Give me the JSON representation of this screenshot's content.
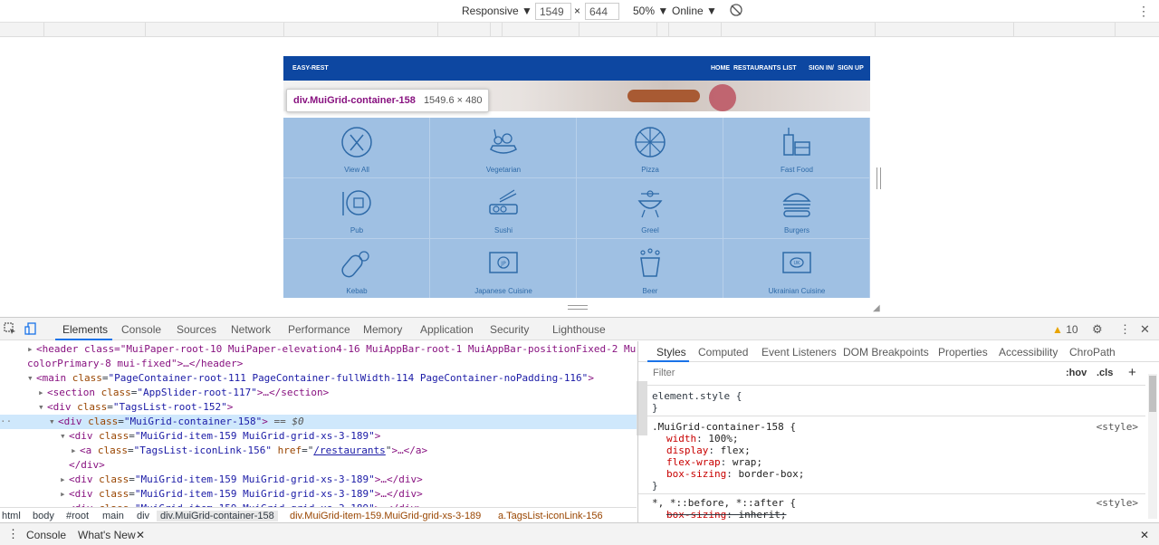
{
  "device_toolbar": {
    "mode": "Responsive",
    "width": "1549",
    "times": "×",
    "height": "644",
    "zoom": "50%",
    "network": "Online"
  },
  "site": {
    "brand": "EASY-REST",
    "nav": [
      "HOME",
      "RESTAURANTS LIST",
      "SIGN IN",
      "/",
      "SIGN UP"
    ],
    "tags": [
      {
        "label": "View All",
        "icon": "cutlery-icon"
      },
      {
        "label": "Vegetarian",
        "icon": "vegetables-icon"
      },
      {
        "label": "Pizza",
        "icon": "pizza-icon"
      },
      {
        "label": "Fast Food",
        "icon": "fast-food-icon"
      },
      {
        "label": "Pub",
        "icon": "pub-icon"
      },
      {
        "label": "Sushi",
        "icon": "sushi-icon"
      },
      {
        "label": "Greel",
        "icon": "grill-icon"
      },
      {
        "label": "Burgers",
        "icon": "burger-icon"
      },
      {
        "label": "Kebab",
        "icon": "kebab-icon"
      },
      {
        "label": "Japanese Cuisine",
        "icon": "japanese-cuisine-icon"
      },
      {
        "label": "Beer",
        "icon": "beer-icon"
      },
      {
        "label": "Ukrainian Cuisine",
        "icon": "ukrainian-cuisine-icon"
      }
    ],
    "icon_badges": {
      "japanese": "JP",
      "ukrainian": "UK"
    }
  },
  "tooltip": {
    "selector": "div.MuiGrid-container-158",
    "dimensions": "1549.6 × 480"
  },
  "devtools": {
    "tabs": [
      "Elements",
      "Console",
      "Sources",
      "Network",
      "Performance",
      "Memory",
      "Application",
      "Security",
      "Lighthouse"
    ],
    "warnings": "10",
    "elements": {
      "l1_a": "<header class=\"MuiPaper-root-10 MuiPaper-elevation4-16 MuiAppBar-root-1 MuiAppBar-positionFixed-2 MuiAppBar-",
      "l1_b": "colorPrimary-8 mui-fixed\">…</header>",
      "main_open_tag": "<main",
      "main_attr": "class",
      "main_val": "\"PageContainer-root-111 PageContainer-fullWidth-114 PageContainer-noPadding-116\"",
      "section_tag": "<section",
      "section_attr": "class",
      "section_val": "\"AppSlider-root-117\"",
      "section_close": ">…</section>",
      "div1_tag": "<div",
      "div1_attr": "class",
      "div1_val": "\"TagsList-root-152\"",
      "div2_tag": "<div",
      "div2_attr": "class",
      "div2_val": "\"MuiGrid-container-158\"",
      "div2_marker": " == $0",
      "div3_tag": "<div",
      "div3_attr": "class",
      "div3_val": "\"MuiGrid-item-159 MuiGrid-grid-xs-3-189\"",
      "a_tag": "<a",
      "a_attr1": "class",
      "a_val1": "\"TagsList-iconLink-156\"",
      "a_attr2": "href",
      "a_href": "/restaurants",
      "a_close": "…</a>",
      "div_close": "</div>",
      "collapsed_close": "…</div>",
      "open_close": ">"
    },
    "breadcrumb": [
      "html",
      "body",
      "#root",
      "main",
      "div",
      "div.MuiGrid-container-158",
      "div.MuiGrid-item-159.MuiGrid-grid-xs-3-189",
      "a.TagsList-iconLink-156"
    ],
    "styles_tabs": [
      "Styles",
      "Computed",
      "Event Listeners",
      "DOM Breakpoints",
      "Properties",
      "Accessibility",
      "ChroPath"
    ],
    "filter_placeholder": "Filter",
    "hov": ":hov",
    "cls": ".cls",
    "plus": "+",
    "element_style": "element.style {",
    "close_brace": "}",
    "rule_selector": ".MuiGrid-container-158 {",
    "rule_source": "<style>",
    "rule_props": [
      {
        "name": "width",
        "value": "100%;"
      },
      {
        "name": "display",
        "value": "flex;"
      },
      {
        "name": "flex-wrap",
        "value": "wrap;"
      },
      {
        "name": "box-sizing",
        "value": "border-box;"
      }
    ],
    "universal_selector": "*, *::before, *::after {",
    "universal_source": "<style>",
    "universal_prop": {
      "name": "box-sizing",
      "value": "inherit;"
    }
  },
  "drawer": {
    "tabs": [
      "Console",
      "What's New"
    ]
  }
}
